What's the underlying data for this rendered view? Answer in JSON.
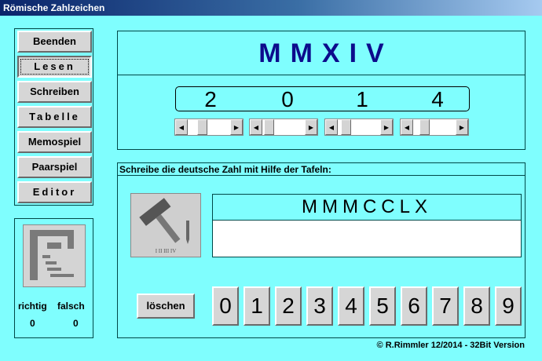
{
  "window": {
    "title": "Römische Zahlzeichen"
  },
  "menu": {
    "items": [
      {
        "label": "Beenden",
        "spaced": false,
        "active": false
      },
      {
        "label": "Lesen",
        "spaced": true,
        "active": true
      },
      {
        "label": "Schreiben",
        "spaced": false,
        "active": false
      },
      {
        "label": "Tabelle",
        "spaced": true,
        "active": false
      },
      {
        "label": "Memospiel",
        "spaced": false,
        "active": false
      },
      {
        "label": "Paarspiel",
        "spaced": false,
        "active": false
      },
      {
        "label": "Editor",
        "spaced": true,
        "active": false
      }
    ]
  },
  "score": {
    "icon": "chart-icon",
    "correct_label": "richtig",
    "wrong_label": "falsch",
    "correct": "0",
    "wrong": "0"
  },
  "reading": {
    "roman": "MMXIV",
    "digits": [
      "2",
      "0",
      "1",
      "4"
    ],
    "sliders": [
      {
        "position": 0.3
      },
      {
        "position": 0.05
      },
      {
        "position": 0.1
      },
      {
        "position": 0.2
      }
    ]
  },
  "writing": {
    "instruction": "Schreibe die deutsche Zahl mit Hilfe der Tafeln:",
    "tool_icon": "hammer-chisel-icon",
    "tool_caption": "I II III IV",
    "target_roman": "MMMCCLX",
    "answer": "",
    "clear_label": "löschen",
    "digit_buttons": [
      "0",
      "1",
      "2",
      "3",
      "4",
      "5",
      "6",
      "7",
      "8",
      "9"
    ]
  },
  "footer": {
    "copyright": "© R.Rimmler 12/2014 - 32Bit Version"
  },
  "colors": {
    "background": "#7ffefe",
    "roman_big": "#0c0c8c",
    "button_face": "#d6d6d6",
    "titlebar": "#0a246a"
  }
}
